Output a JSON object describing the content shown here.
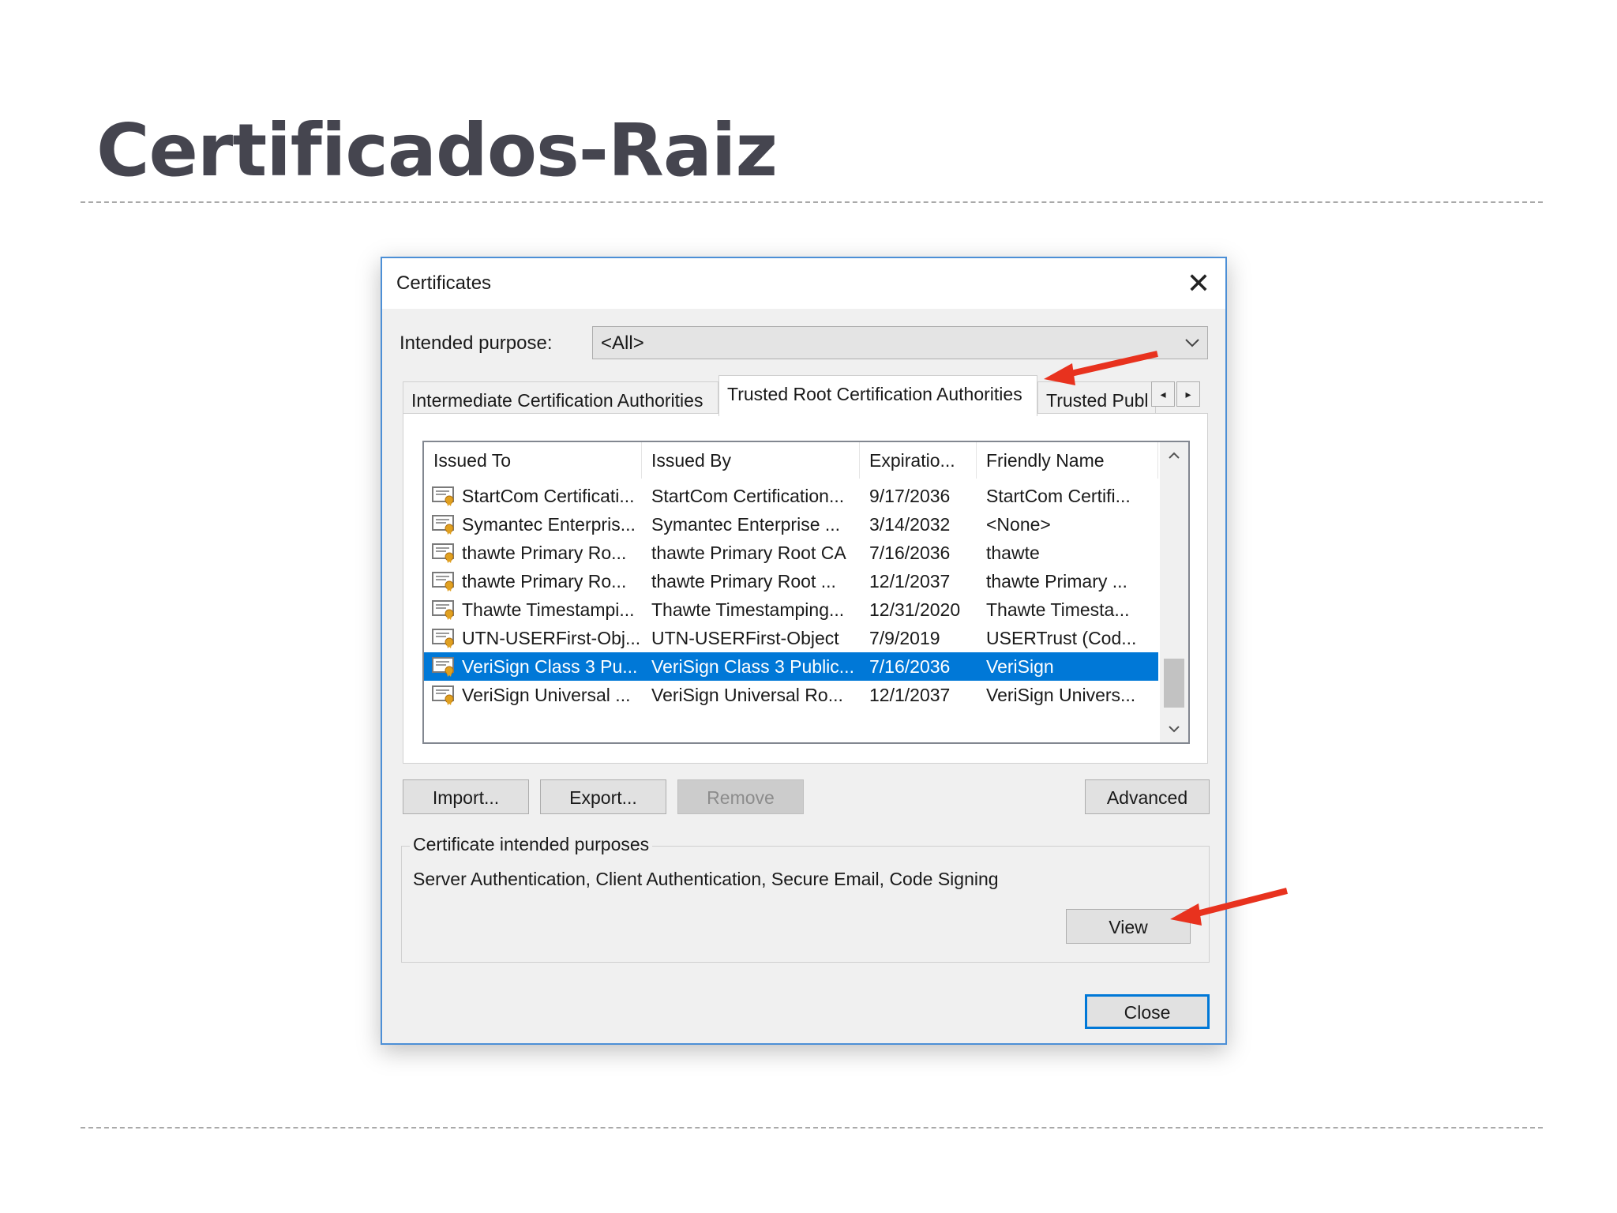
{
  "slide": {
    "title": "Certificados-Raiz"
  },
  "dialog": {
    "title": "Certificates",
    "close_glyph": "✕",
    "intended_purpose_label": "Intended purpose:",
    "intended_purpose_value": "<All>",
    "tabs": [
      {
        "label": "Intermediate Certification Authorities",
        "selected": false
      },
      {
        "label": "Trusted Root Certification Authorities",
        "selected": true
      },
      {
        "label": "Trusted Publ",
        "selected": false
      }
    ],
    "tab_scroll": {
      "left": "◂",
      "right": "▸"
    },
    "columns": [
      "Issued To",
      "Issued By",
      "Expiratio...",
      "Friendly Name"
    ],
    "rows": [
      {
        "issued_to": "StartCom Certificati...",
        "issued_by": "StartCom Certification...",
        "expiration": "9/17/2036",
        "friendly_name": "StartCom Certifi..."
      },
      {
        "issued_to": "Symantec Enterpris...",
        "issued_by": "Symantec Enterprise ...",
        "expiration": "3/14/2032",
        "friendly_name": "<None>"
      },
      {
        "issued_to": "thawte Primary Ro...",
        "issued_by": "thawte Primary Root CA",
        "expiration": "7/16/2036",
        "friendly_name": "thawte"
      },
      {
        "issued_to": "thawte Primary Ro...",
        "issued_by": "thawte Primary Root ...",
        "expiration": "12/1/2037",
        "friendly_name": "thawte Primary ..."
      },
      {
        "issued_to": "Thawte Timestampi...",
        "issued_by": "Thawte Timestamping...",
        "expiration": "12/31/2020",
        "friendly_name": "Thawte Timesta..."
      },
      {
        "issued_to": "UTN-USERFirst-Obj...",
        "issued_by": "UTN-USERFirst-Object",
        "expiration": "7/9/2019",
        "friendly_name": "USERTrust (Cod..."
      },
      {
        "issued_to": "VeriSign Class 3 Pu...",
        "issued_by": "VeriSign Class 3 Public...",
        "expiration": "7/16/2036",
        "friendly_name": "VeriSign",
        "selected": true
      },
      {
        "issued_to": "VeriSign Universal ...",
        "issued_by": "VeriSign Universal Ro...",
        "expiration": "12/1/2037",
        "friendly_name": "VeriSign Univers..."
      }
    ],
    "scroll": {
      "up": "^",
      "down": "v"
    },
    "buttons": {
      "import": "Import...",
      "export": "Export...",
      "remove": "Remove",
      "advanced": "Advanced",
      "view": "View",
      "close": "Close"
    },
    "purposes_group": {
      "legend": "Certificate intended purposes",
      "text": "Server Authentication, Client Authentication, Secure Email, Code Signing"
    }
  },
  "colors": {
    "accent": "#0078d7",
    "annotation_arrow": "#e8321e",
    "title_text": "#45454f",
    "dialog_border": "#4c8fd6"
  },
  "icons": [
    "close-icon",
    "chevron-down-icon",
    "certificate-icon",
    "scroll-left-icon",
    "scroll-right-icon",
    "scroll-up-icon",
    "scroll-down-icon"
  ]
}
